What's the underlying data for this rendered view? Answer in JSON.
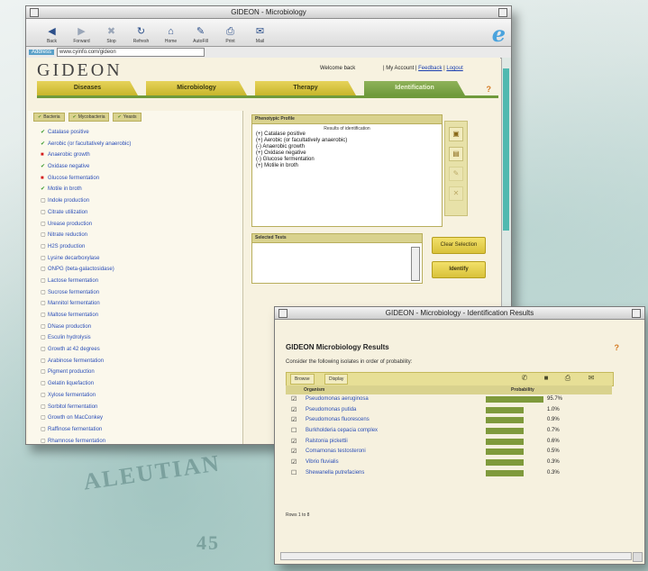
{
  "background": {
    "words": [
      "ALEUTIAN",
      "45"
    ]
  },
  "main_window": {
    "title": "GIDEON - Microbiology",
    "toolbar": [
      {
        "label": "Back",
        "icon": "back-arrow-icon"
      },
      {
        "label": "Forward",
        "icon": "forward-arrow-icon"
      },
      {
        "label": "Stop",
        "icon": "stop-icon"
      },
      {
        "label": "Refresh",
        "icon": "refresh-icon"
      },
      {
        "label": "Home",
        "icon": "home-icon"
      },
      {
        "label": "AutoFill",
        "icon": "autofill-icon"
      },
      {
        "label": "Print",
        "icon": "print-icon"
      },
      {
        "label": "Mail",
        "icon": "mail-icon"
      }
    ],
    "address_label": "Address",
    "address_value": "www.cyinfo.com/gideon",
    "logo": "GIDEON",
    "welcome": "Welcome back",
    "top_links": {
      "prefix": "| My Account |",
      "link1": "Feedback",
      "sep": "|",
      "link2": "Logout"
    },
    "nav_tabs": [
      "Diseases",
      "Microbiology",
      "Therapy",
      "Identification"
    ],
    "active_tab": 3,
    "subtabs": [
      "Bacteria",
      "Mycobacteria",
      "Yeasts"
    ],
    "items": [
      {
        "mark": "green",
        "text": "Catalase positive"
      },
      {
        "mark": "green",
        "text": "Aerobic (or facultatively anaerobic)"
      },
      {
        "mark": "red",
        "text": "Anaerobic growth"
      },
      {
        "mark": "green",
        "text": "Oxidase negative"
      },
      {
        "mark": "red",
        "text": "Glucose fermentation"
      },
      {
        "mark": "green",
        "text": "Motile in broth"
      },
      {
        "mark": "box",
        "text": "Indole production"
      },
      {
        "mark": "box",
        "text": "Citrate utilization"
      },
      {
        "mark": "box",
        "text": "Urease production"
      },
      {
        "mark": "box",
        "text": "Nitrate reduction"
      },
      {
        "mark": "box",
        "text": "H2S production"
      },
      {
        "mark": "box",
        "text": "Lysine decarboxylase"
      },
      {
        "mark": "box",
        "text": "ONPG (beta-galactosidase)"
      },
      {
        "mark": "box",
        "text": "Lactose fermentation"
      },
      {
        "mark": "box",
        "text": "Sucrose fermentation"
      },
      {
        "mark": "box",
        "text": "Mannitol fermentation"
      },
      {
        "mark": "box",
        "text": "Maltose fermentation"
      },
      {
        "mark": "box",
        "text": "DNase production"
      },
      {
        "mark": "box",
        "text": "Esculin hydrolysis"
      },
      {
        "mark": "box",
        "text": "Growth at 42 degrees"
      },
      {
        "mark": "box",
        "text": "Arabinose fermentation"
      },
      {
        "mark": "box",
        "text": "Pigment production"
      },
      {
        "mark": "box",
        "text": "Gelatin liquefaction"
      },
      {
        "mark": "box",
        "text": "Xylose fermentation"
      },
      {
        "mark": "box",
        "text": "Sorbitol fermentation"
      },
      {
        "mark": "box",
        "text": "Growth on MacConkey"
      },
      {
        "mark": "box",
        "text": "Raffinose fermentation"
      },
      {
        "mark": "box",
        "text": "Rhamnose fermentation"
      }
    ],
    "selected_header": "Phenotypic Profile",
    "selected_title": "Results of identification",
    "selected_lines": [
      "(+) Catalase positive",
      "(+) Aerobic (or facultatively anaerobic)",
      "(-) Anaerobic growth",
      "(+) Oxidase negative",
      "(-) Glucose fermentation",
      "(+) Motile in broth"
    ],
    "reference_header": "Selected Tests",
    "btn_clear": "Clear Selection",
    "btn_identify": "Identify"
  },
  "popup": {
    "title": "GIDEON - Microbiology - Identification Results",
    "heading": "GIDEON Microbiology Results",
    "subtitle": "Consider the following isolates in order of probability:",
    "btn1": "Browse",
    "btn2": "Display",
    "col1": "Organism",
    "col2": "Probability",
    "rows": [
      {
        "name": "Pseudomonas aeruginosa",
        "pct": 95.7,
        "label": "95.7%",
        "checked": true
      },
      {
        "name": "Pseudomonas putida",
        "pct": 1.0,
        "label": "1.0%",
        "checked": true
      },
      {
        "name": "Pseudomonas fluorescens",
        "pct": 0.9,
        "label": "0.9%",
        "checked": true
      },
      {
        "name": "Burkholderia cepacia complex",
        "pct": 0.7,
        "label": "0.7%",
        "checked": false
      },
      {
        "name": "Ralstonia pickettii",
        "pct": 0.6,
        "label": "0.6%",
        "checked": true
      },
      {
        "name": "Comamonas testosteroni",
        "pct": 0.5,
        "label": "0.5%",
        "checked": true
      },
      {
        "name": "Vibrio fluvialis",
        "pct": 0.3,
        "label": "0.3%",
        "checked": true
      },
      {
        "name": "Shewanella putrefaciens",
        "pct": 0.3,
        "label": "0.3%",
        "checked": false
      }
    ],
    "footer": "Rows 1 to 8"
  }
}
